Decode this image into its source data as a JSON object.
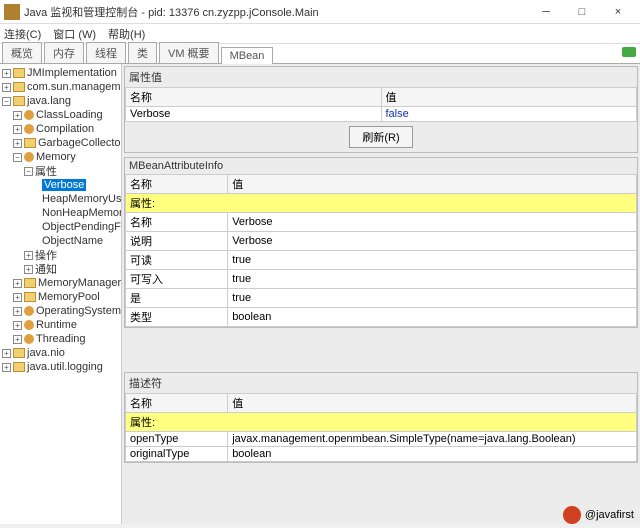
{
  "window": {
    "title": "Java 监视和管理控制台 - pid: 13376 cn.zyzpp.jConsole.Main",
    "min": "─",
    "max": "□",
    "close": "×"
  },
  "menu": {
    "connect": "连接(C)",
    "window": "窗口 (W)",
    "help": "帮助(H)"
  },
  "tabs": [
    "概览",
    "内存",
    "线程",
    "类",
    "VM 概要",
    "MBean"
  ],
  "activeTab": "MBean",
  "tree": {
    "t0": "JMImplementation",
    "t1": "com.sun.management",
    "t2": "java.lang",
    "t2a": "ClassLoading",
    "t2b": "Compilation",
    "t2c": "GarbageCollector",
    "t2d": "Memory",
    "t2d0": "属性",
    "t2d0a": "Verbose",
    "t2d0b": "HeapMemoryUsag",
    "t2d0c": "NonHeapMemoryU",
    "t2d0d": "ObjectPendingF",
    "t2d0e": "ObjectName",
    "t2d1": "操作",
    "t2d2": "通知",
    "t2e": "MemoryManager",
    "t2f": "MemoryPool",
    "t2g": "OperatingSystem",
    "t2h": "Runtime",
    "t2i": "Threading",
    "t3": "java.nio",
    "t4": "java.util.logging"
  },
  "attrValue": {
    "title": "属性值",
    "hName": "名称",
    "hValue": "值",
    "rName": "Verbose",
    "rValue": "false",
    "refresh": "刷新(R)"
  },
  "attrInfo": {
    "title": "MBeanAttributeInfo",
    "hName": "名称",
    "hValue": "值",
    "rowLabel": "属性:",
    "rows": [
      {
        "n": "名称",
        "v": "Verbose"
      },
      {
        "n": "说明",
        "v": "Verbose"
      },
      {
        "n": "可读",
        "v": "true"
      },
      {
        "n": "可写入",
        "v": "true"
      },
      {
        "n": "是",
        "v": "true"
      },
      {
        "n": "类型",
        "v": "boolean"
      }
    ]
  },
  "descriptor": {
    "title": "描述符",
    "hName": "名称",
    "hValue": "值",
    "rowLabel": "属性:",
    "rows": [
      {
        "n": "openType",
        "v": "javax.management.openmbean.SimpleType(name=java.lang.Boolean)"
      },
      {
        "n": "originalType",
        "v": "boolean"
      }
    ]
  },
  "footer": "@javafirst"
}
